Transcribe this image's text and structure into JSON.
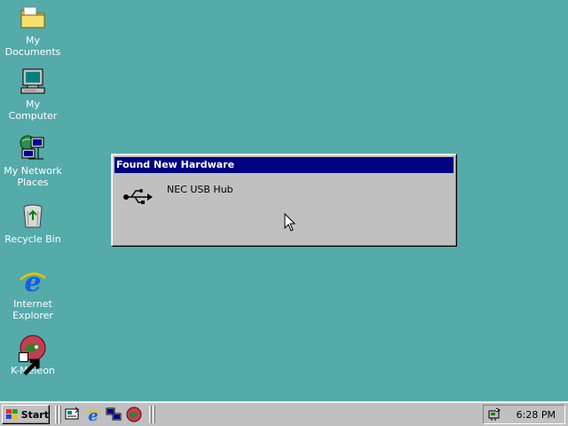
{
  "desktop": {
    "background": "#55aaaa",
    "icons": [
      {
        "label": "My Documents",
        "icon": "folder-icon"
      },
      {
        "label": "My Computer",
        "icon": "computer-icon"
      },
      {
        "label": "My Network Places",
        "icon": "network-icon"
      },
      {
        "label": "Recycle Bin",
        "icon": "recycle-bin-icon"
      },
      {
        "label": "Internet Explorer",
        "icon": "internet-explorer-icon"
      },
      {
        "label": "K-Meleon",
        "icon": "k-meleon-icon"
      }
    ]
  },
  "dialog": {
    "title": "Found New Hardware",
    "device_name": "NEC USB Hub",
    "icon": "usb-icon"
  },
  "taskbar": {
    "start_label": "Start",
    "quick_launch": [
      "show-desktop-icon",
      "internet-explorer-icon",
      "network-icon",
      "k-meleon-icon"
    ],
    "tray_icon": "hardware-tray-icon",
    "clock": "6:28 PM"
  }
}
